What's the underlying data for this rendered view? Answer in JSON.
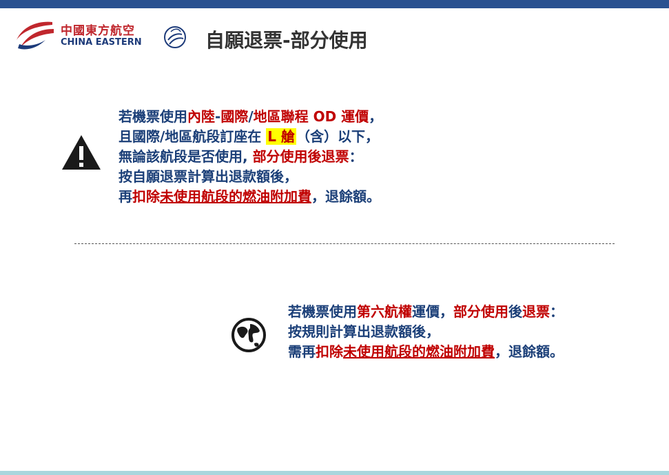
{
  "logo": {
    "cn": "中國東方航空",
    "en": "CHINA EASTERN",
    "alliance": "SKYTEAM"
  },
  "title": "自願退票-部分使用",
  "section1": {
    "icon": "warning-icon",
    "l1_a": "若機票使用",
    "l1_b": "內陸",
    "l1_c": "-",
    "l1_d": "國際",
    "l1_e": "/",
    "l1_f": "地區聯程 OD 運價",
    "l1_g": "，",
    "l2_a": "且國際/地區航段訂座在",
    "l2_b": "L 艙",
    "l2_c": "（含）以下，",
    "l3_a": "無論該航段是否使用, ",
    "l3_b": "部分使用後退票",
    "l3_c": "：",
    "l4": "按自願退票計算出退款額後，",
    "l5_a": "再",
    "l5_b": "扣除",
    "l5_c": "未使用航段的燃油附加費",
    "l5_d": "，退餘額。"
  },
  "section2": {
    "icon": "globe-icon",
    "l1_a": "若機票使用",
    "l1_b": "第六航權",
    "l1_c": "運價，",
    "l1_d": "部分使用",
    "l1_e": "後",
    "l1_f": "退票",
    "l1_g": "：",
    "l2": "按規則計算出退款額後，",
    "l3_a": "需再",
    "l3_b": "扣除",
    "l3_c": "未使用航段的燃油附加費",
    "l3_d": "，退餘額。"
  },
  "colors": {
    "top_bar": "#2a5190",
    "bottom_bar": "#a9d6dd",
    "text_blue": "#1b3f78",
    "text_red": "#c00000",
    "highlight": "#ffff00"
  }
}
